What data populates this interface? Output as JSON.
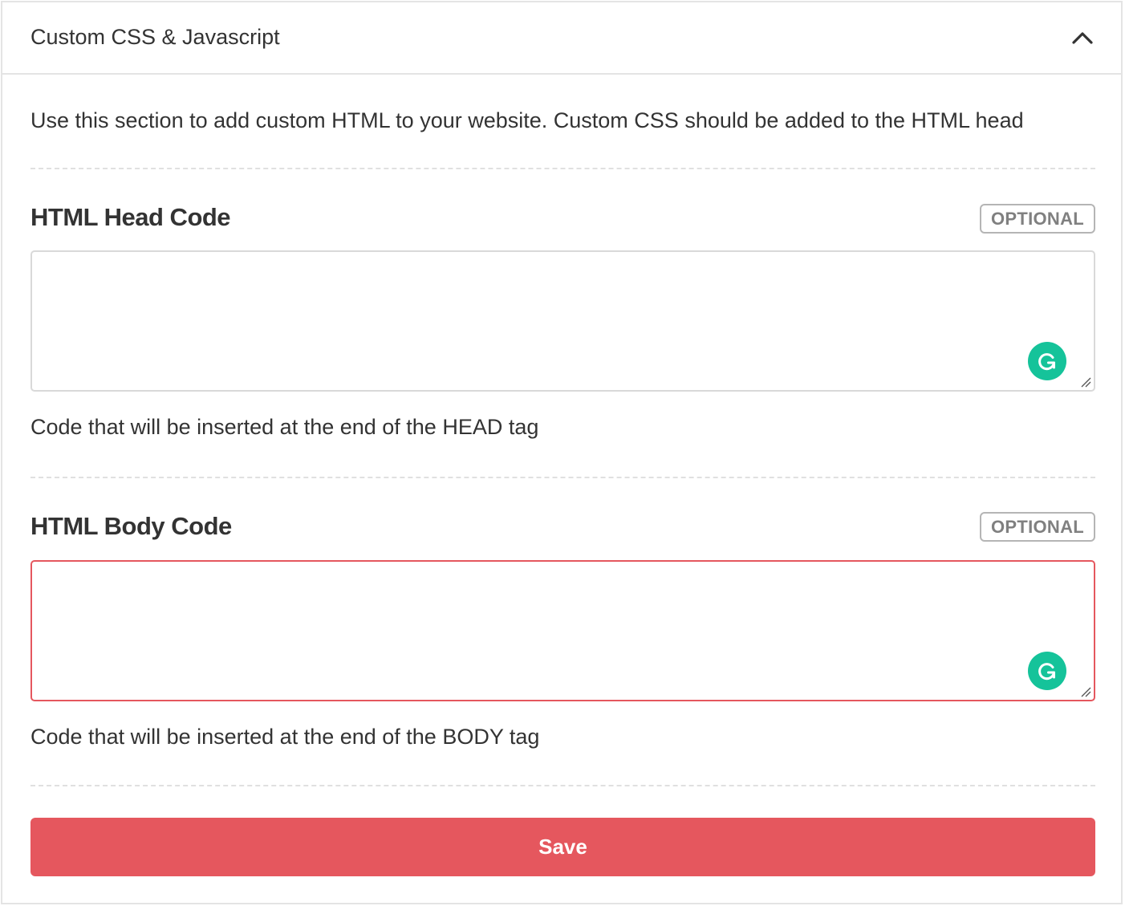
{
  "panel": {
    "title": "Custom CSS & Javascript",
    "collapse_icon": "chevron-up-icon",
    "intro": "Use this section to add custom HTML to your website. Custom CSS should be added to the HTML head"
  },
  "head_field": {
    "label": "HTML Head Code",
    "badge": "OPTIONAL",
    "value": "",
    "help": "Code that will be inserted at the end of the HEAD tag",
    "assistant_icon": "grammarly-icon"
  },
  "body_field": {
    "label": "HTML Body Code",
    "badge": "OPTIONAL",
    "value": "",
    "help": "Code that will be inserted at the end of the BODY tag",
    "state": "error",
    "assistant_icon": "grammarly-icon"
  },
  "save_button": {
    "label": "Save"
  },
  "colors": {
    "accent": "#e5575e",
    "grammarly": "#15c39a",
    "text": "#333333",
    "badge_text": "#808080",
    "border": "#e4e4e4"
  }
}
